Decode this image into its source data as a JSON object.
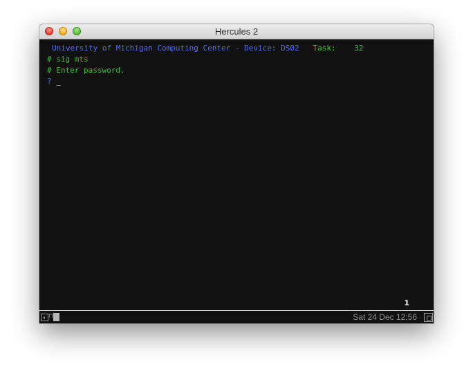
{
  "window": {
    "title": "Hercules 2"
  },
  "terminal": {
    "lines": [
      {
        "text": "University of Michigan Computing Center - Device: DS02",
        "color": "#5a6cf0"
      },
      {
        "text": "# sig mts",
        "color": "#39c23a"
      },
      {
        "text": "# Enter password.",
        "color": "#39c23a"
      },
      {
        "text": "? ",
        "color": "#5a6cf0"
      }
    ],
    "task_label": "Task:",
    "task_value": "32",
    "cursor": "_",
    "page_number": "1"
  },
  "statusbar": {
    "datetime": "Sat 24 Dec 12:56",
    "lock_glyph": "🔒"
  },
  "colors": {
    "background": "#111111",
    "prompt_blue": "#5a6cf0",
    "text_green": "#39c23a"
  }
}
